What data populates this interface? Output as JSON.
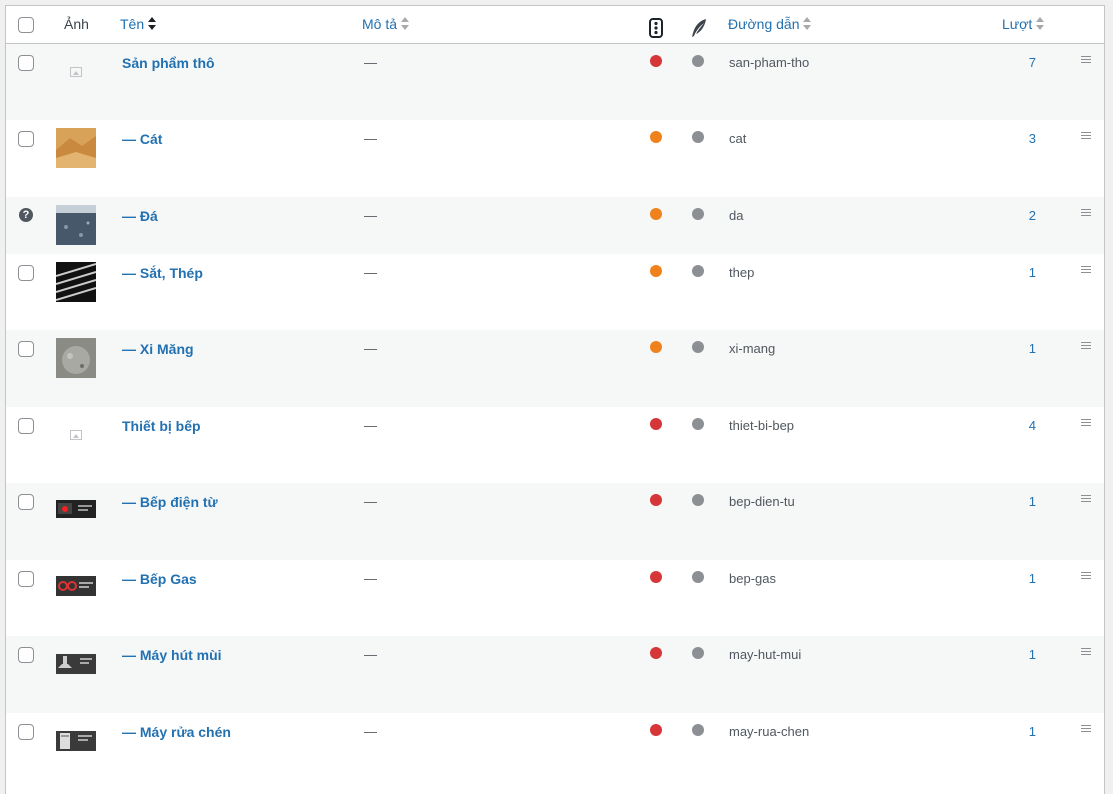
{
  "columns": {
    "image": "Ảnh",
    "name": "Tên",
    "description": "Mô tả",
    "slug": "Đường dẫn",
    "count": "Lượt",
    "status_icon": "traffic-light-icon",
    "seo_icon": "feather-icon"
  },
  "colors": {
    "link": "#2271b1",
    "dot_red": "#d63638",
    "dot_orange": "#f0821e",
    "dot_gray": "#8c8f94"
  },
  "rows": [
    {
      "name": "Sản phẩm thô",
      "description": "—",
      "slug": "san-pham-tho",
      "count": "7",
      "status": "red",
      "thumb": "placeholder"
    },
    {
      "name": "— Cát",
      "description": "—",
      "slug": "cat",
      "count": "3",
      "status": "orange",
      "thumb": "sand"
    },
    {
      "name": "— Đá",
      "description": "—",
      "slug": "da",
      "count": "2",
      "status": "orange",
      "thumb": "stone"
    },
    {
      "name": "— Sắt, Thép",
      "description": "—",
      "slug": "thep",
      "count": "1",
      "status": "orange",
      "thumb": "steel"
    },
    {
      "name": "— Xi Măng",
      "description": "—",
      "slug": "xi-mang",
      "count": "1",
      "status": "orange",
      "thumb": "cement"
    },
    {
      "name": "Thiết bị bếp",
      "description": "—",
      "slug": "thiet-bi-bep",
      "count": "4",
      "status": "red",
      "thumb": "placeholder"
    },
    {
      "name": "— Bếp điện từ",
      "description": "—",
      "slug": "bep-dien-tu",
      "count": "1",
      "status": "red",
      "thumb": "induction"
    },
    {
      "name": "— Bếp Gas",
      "description": "—",
      "slug": "bep-gas",
      "count": "1",
      "status": "red",
      "thumb": "gas"
    },
    {
      "name": "— Máy hút mùi",
      "description": "—",
      "slug": "may-hut-mui",
      "count": "1",
      "status": "red",
      "thumb": "hood"
    },
    {
      "name": "— Máy rửa chén",
      "description": "—",
      "slug": "may-rua-chen",
      "count": "1",
      "status": "red",
      "thumb": "dishwasher"
    }
  ]
}
